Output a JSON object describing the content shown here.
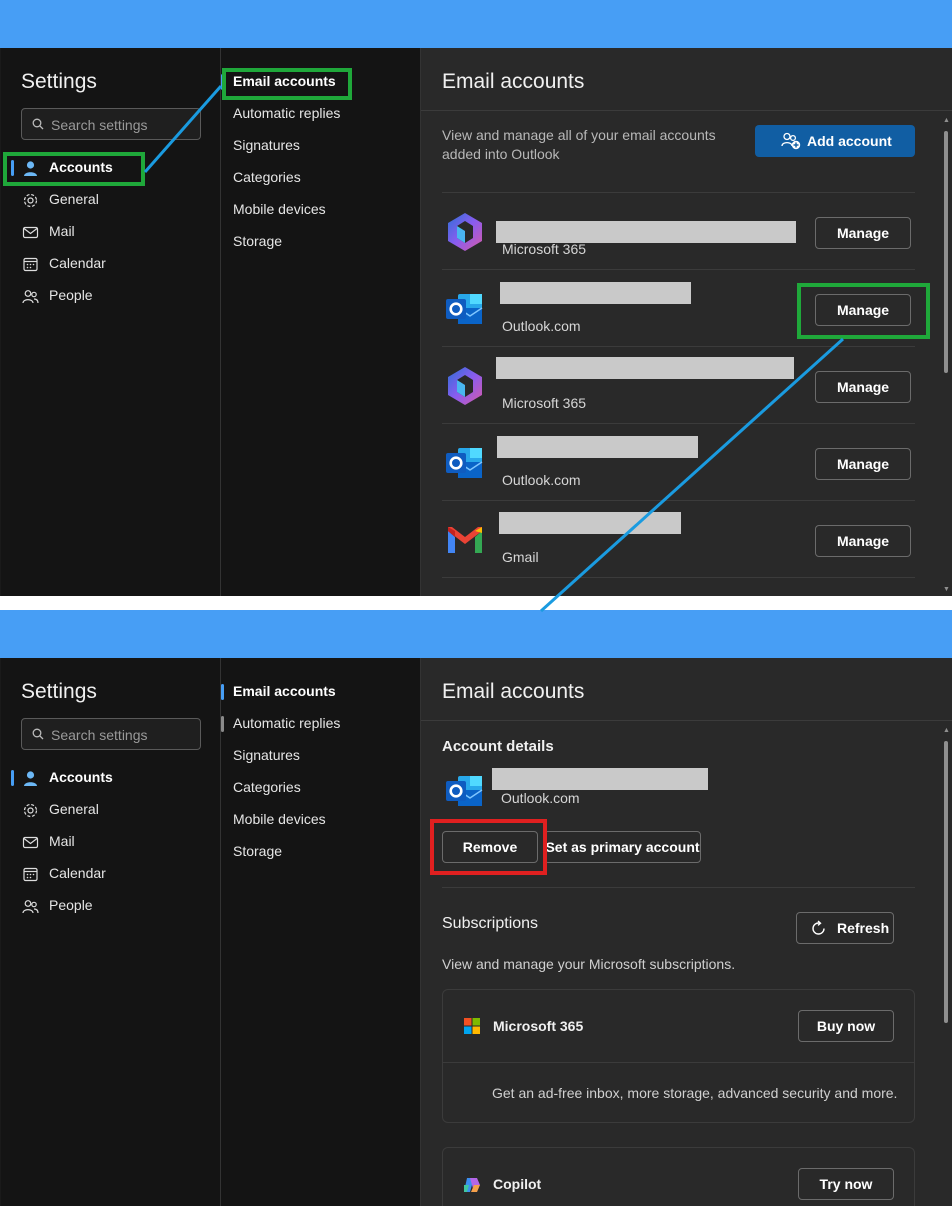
{
  "top": {
    "nav": {
      "title": "Settings",
      "search_placeholder": "Search settings",
      "items": [
        {
          "label": "Accounts",
          "icon": "person-icon"
        },
        {
          "label": "General",
          "icon": "gear-icon"
        },
        {
          "label": "Mail",
          "icon": "mail-icon"
        },
        {
          "label": "Calendar",
          "icon": "calendar-icon"
        },
        {
          "label": "People",
          "icon": "people-icon"
        }
      ]
    },
    "subnav": [
      "Email accounts",
      "Automatic replies",
      "Signatures",
      "Categories",
      "Mobile devices",
      "Storage"
    ],
    "content": {
      "title": "Email accounts",
      "intro": "View and manage all of your email accounts added into Outlook",
      "add_button": "Add account",
      "manage_label": "Manage",
      "accounts": [
        {
          "type": "Microsoft 365",
          "logo": "microsoft-365-logo"
        },
        {
          "type": "Outlook.com",
          "logo": "outlook-logo"
        },
        {
          "type": "Microsoft 365",
          "logo": "microsoft-365-logo"
        },
        {
          "type": "Outlook.com",
          "logo": "outlook-logo"
        },
        {
          "type": "Gmail",
          "logo": "gmail-logo"
        }
      ]
    }
  },
  "bottom": {
    "nav": {
      "title": "Settings",
      "search_placeholder": "Search settings",
      "items": [
        {
          "label": "Accounts",
          "icon": "person-icon"
        },
        {
          "label": "General",
          "icon": "gear-icon"
        },
        {
          "label": "Mail",
          "icon": "mail-icon"
        },
        {
          "label": "Calendar",
          "icon": "calendar-icon"
        },
        {
          "label": "People",
          "icon": "people-icon"
        }
      ]
    },
    "subnav": [
      "Email accounts",
      "Automatic replies",
      "Signatures",
      "Categories",
      "Mobile devices",
      "Storage"
    ],
    "content": {
      "title": "Email accounts",
      "account_details_title": "Account details",
      "account_type": "Outlook.com",
      "remove_button": "Remove",
      "primary_button": "Set as primary account",
      "subscriptions_title": "Subscriptions",
      "refresh_button": "Refresh",
      "subscriptions_text": "View and manage your Microsoft subscriptions.",
      "cards": [
        {
          "name": "Microsoft 365",
          "button": "Buy now",
          "desc": "Get an ad-free inbox, more storage, advanced security and more."
        },
        {
          "name": "Copilot",
          "button": "Try now"
        }
      ]
    }
  },
  "colors": {
    "accent_blue": "#479ef5",
    "primary_button": "#115ea3",
    "annotation_green": "#1fa83a",
    "annotation_red": "#e02020",
    "annotation_line": "#1a9be0"
  }
}
